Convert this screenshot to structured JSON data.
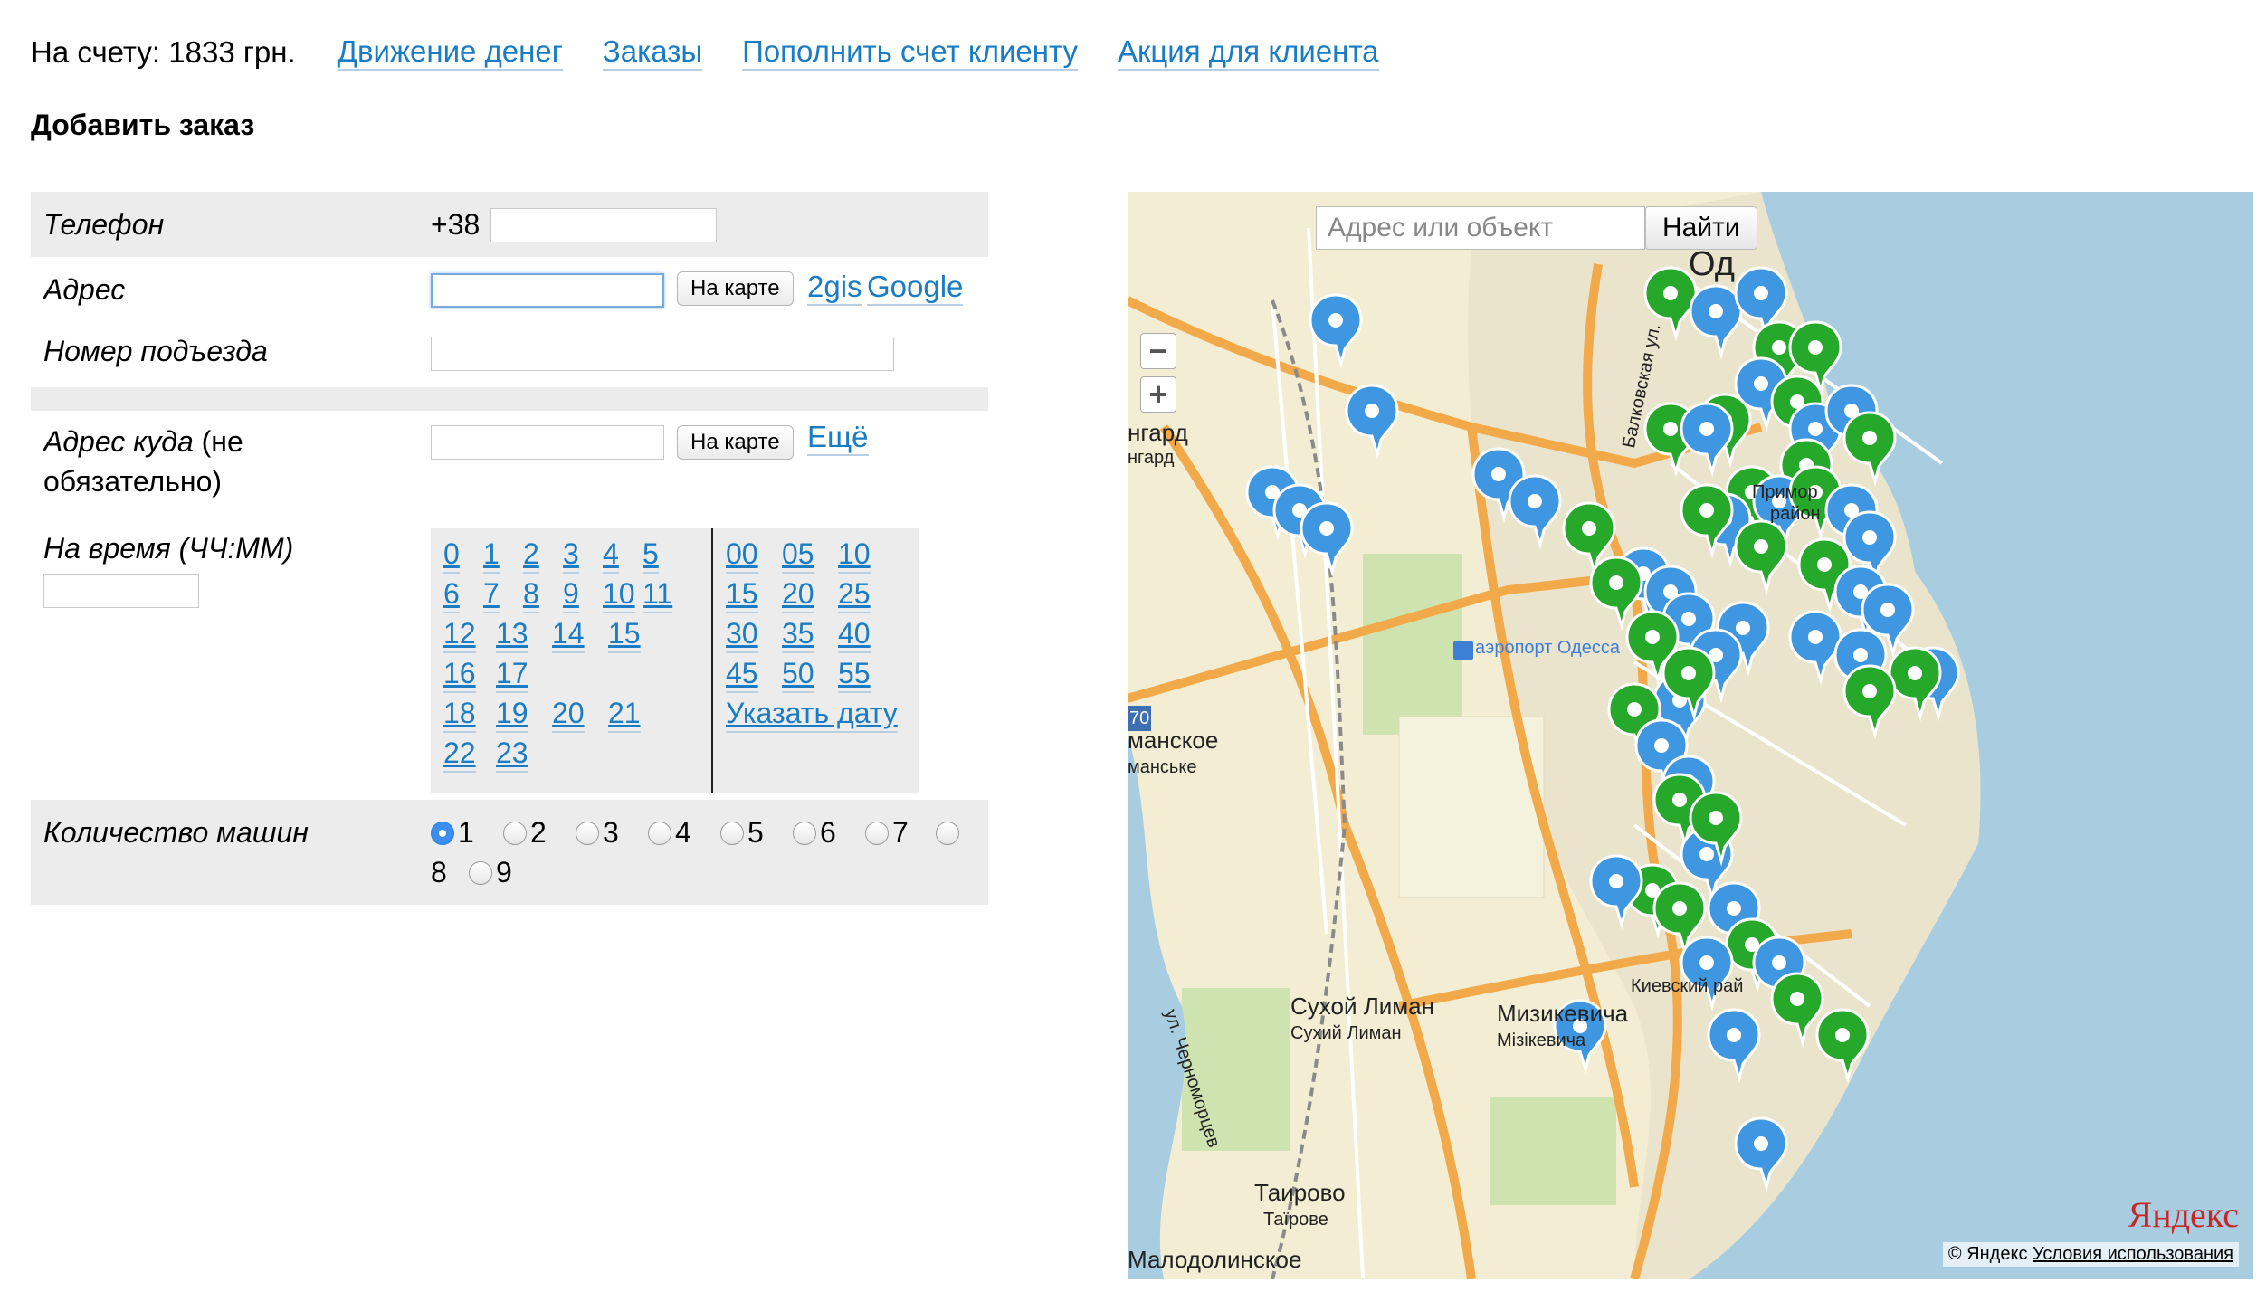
{
  "topbar": {
    "balance": "На счету: 1833 грн.",
    "links": [
      "Движение денег",
      "Заказы",
      "Пополнить счет клиенту",
      "Акция для клиента"
    ]
  },
  "title": "Добавить заказ",
  "form": {
    "phone_label": "Телефон",
    "phone_prefix": "+38",
    "phone_value": "",
    "address_label": "Адрес",
    "address_value": "",
    "map_button": "На карте",
    "link_2gis": "2gis",
    "link_google": "Google",
    "entrance_label": "Номер подъезда",
    "dest_label_1": "Адрес куда",
    "dest_label_2": "(не",
    "dest_label_3": "обязательно)",
    "dest_map_button": "На карте",
    "dest_more": "Ещё",
    "time_label": "На время (ЧЧ:ММ)",
    "time_value": "",
    "hours": [
      "0",
      "1",
      "2",
      "3",
      "4",
      "5",
      "6",
      "7",
      "8",
      "9",
      "10",
      "11",
      "12",
      "13",
      "14",
      "15",
      "16",
      "17",
      "18",
      "19",
      "20",
      "21",
      "22",
      "23"
    ],
    "minutes": [
      "00",
      "05",
      "10",
      "15",
      "20",
      "25",
      "30",
      "35",
      "40",
      "45",
      "50",
      "55"
    ],
    "pick_date": "Указать дату",
    "cars_label": "Количество машин",
    "cars_options": [
      "1",
      "2",
      "3",
      "4",
      "5",
      "6",
      "7",
      "8",
      "9"
    ],
    "cars_selected": "1"
  },
  "map": {
    "search_placeholder": "Адрес или объект",
    "search_button": "Найти",
    "zoom_out": "−",
    "zoom_in": "+",
    "labels": {
      "odessa": "Од",
      "angard1": "нгард",
      "angard2": "нгард",
      "airport": "аэропорт Одесса",
      "mansk1": "манское",
      "mansk2": "манське",
      "sukhoy1": "Сухой Лиман",
      "sukhoy2": "Сухий Лиман",
      "miz1": "Мизикевича",
      "miz2": "Мізікевича",
      "kiev": "Киевский рай",
      "tair1": "Таирово",
      "tair2": "Таїрове",
      "malod": "Малодолинское",
      "chern": "ул. Черноморцев",
      "balk": "Балковская ул.",
      "prim1": "Примор",
      "prim2": "район",
      "road70": "70"
    },
    "logo": "Яндекс",
    "copyright": "© Яндекс",
    "terms": "Условия использования",
    "colors": {
      "blue_pin": "#3e97e0",
      "green_pin": "#26a82b",
      "sea": "#a8cde0",
      "land": "#f3eed3"
    }
  }
}
